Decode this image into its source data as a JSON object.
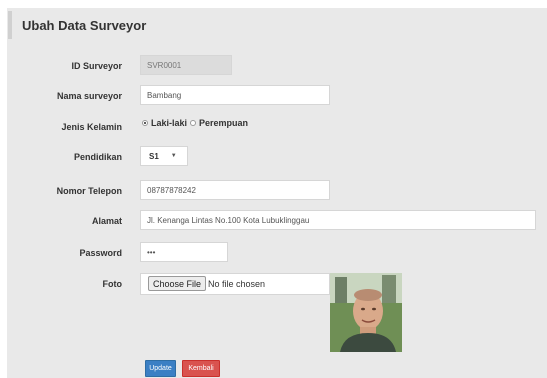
{
  "page": {
    "title": "Ubah Data Surveyor"
  },
  "form": {
    "id_label": "ID Surveyor",
    "id_value": "SVR0001",
    "name_label": "Nama surveyor",
    "name_value": "Bambang",
    "gender_label": "Jenis Kelamin",
    "gender_options": [
      "Laki-laki",
      "Perempuan"
    ],
    "gender_selected": "Laki-laki",
    "education_label": "Pendidikan",
    "education_value": "S1",
    "phone_label": "Nomor Telepon",
    "phone_value": "08787878242",
    "address_label": "Alamat",
    "address_value": "Jl. Kenanga Lintas No.100 Kota Lubuklinggau",
    "password_label": "Password",
    "password_value": "•••",
    "photo_label": "Foto",
    "choose_file_label": "Choose File",
    "file_status": "No file chosen"
  },
  "buttons": {
    "update": "Update",
    "back": "Kembali"
  },
  "colors": {
    "update": "#3b7fc4",
    "back": "#d9534f",
    "panel": "#e9e9e9"
  }
}
